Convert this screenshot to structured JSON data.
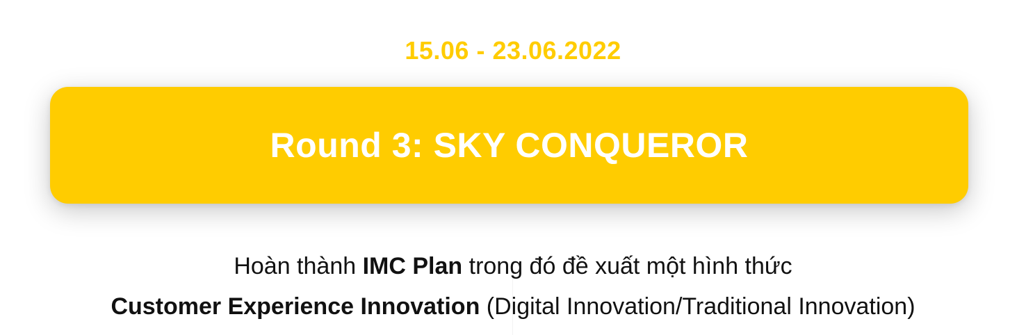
{
  "date_range": "15.06 - 23.06.2022",
  "round": {
    "title": "Round 3: SKY CONQUEROR"
  },
  "description": {
    "line1_pre": "Hoàn thành ",
    "line1_bold": "IMC Plan",
    "line1_post": " trong đó đề xuất một hình thức",
    "line2_bold": "Customer Experience Innovation",
    "line2_post": " (Digital Innovation/Traditional Innovation)"
  },
  "colors": {
    "accent": "#ffcc00",
    "title_text": "#ffffff",
    "body_text": "#111111"
  }
}
